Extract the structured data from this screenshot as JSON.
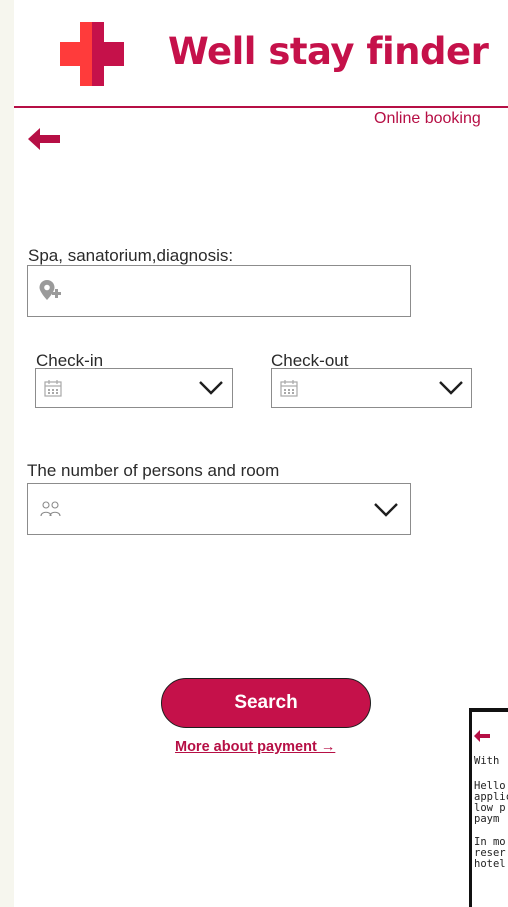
{
  "header": {
    "app_name": "Well stay finder",
    "tagline": "Online booking",
    "brand_color": "#c5114a",
    "logo_colors": [
      "#ff3b3b",
      "#c5114a"
    ]
  },
  "form": {
    "search_label": "Spa, sanatorium,diagnosis:",
    "search_value": "",
    "checkin_label": "Check-in",
    "checkout_label": "Check-out",
    "persons_label": "The number of persons and room"
  },
  "actions": {
    "search_button": "Search",
    "payment_link": "More about payment →"
  },
  "preview": {
    "lines": [
      "With",
      "Hello",
      "applic",
      "low p",
      "paym",
      "In mo",
      "reser",
      "hotel"
    ]
  },
  "icons": {
    "back": "arrow-left-icon",
    "location": "location-pin-plus-icon",
    "calendar": "calendar-icon",
    "people": "people-icon",
    "chevron": "chevron-down-icon"
  }
}
